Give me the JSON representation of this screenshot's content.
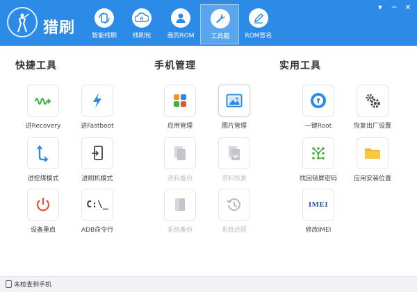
{
  "app": {
    "name": "猎刷"
  },
  "nav": {
    "tabs": [
      {
        "label": "智能线刷",
        "icon": "refresh-phone-icon"
      },
      {
        "label": "线刷包",
        "icon": "rom-package-icon"
      },
      {
        "label": "我的ROM",
        "icon": "user-icon"
      },
      {
        "label": "工具箱",
        "icon": "wrench-icon",
        "active": true
      },
      {
        "label": "ROM签名",
        "icon": "pen-icon"
      }
    ]
  },
  "window_controls": {
    "menu": "▾",
    "minimize": "─",
    "close": "✕"
  },
  "sections": {
    "quick": {
      "title": "快捷工具",
      "items": [
        {
          "label": "进Recovery",
          "icon": "wave-arrow-icon"
        },
        {
          "label": "进Fastboot",
          "icon": "lightning-icon"
        },
        {
          "label": "进挖煤模式",
          "icon": "hook-arrow-icon"
        },
        {
          "label": "进刷机模式",
          "icon": "enter-phone-icon"
        },
        {
          "label": "设备重启",
          "icon": "restart-icon"
        },
        {
          "label": "ADB命令行",
          "icon": "terminal-icon",
          "glyph": "C:\\_"
        }
      ]
    },
    "phone": {
      "title": "手机管理",
      "items": [
        {
          "label": "应用管理",
          "icon": "apps-grid-icon",
          "enabled": true
        },
        {
          "label": "图片管理",
          "icon": "picture-icon",
          "enabled": true
        },
        {
          "label": "资料备份",
          "icon": "backup-doc-icon",
          "enabled": false
        },
        {
          "label": "资料恢复",
          "icon": "restore-doc-icon",
          "enabled": false
        },
        {
          "label": "系统备份",
          "icon": "system-backup-icon",
          "enabled": false
        },
        {
          "label": "系统还原",
          "icon": "history-icon",
          "enabled": false
        }
      ]
    },
    "utility": {
      "title": "实用工具",
      "items": [
        {
          "label": "一键Root",
          "icon": "root-lock-icon"
        },
        {
          "label": "恢复出厂设置",
          "icon": "gears-icon"
        },
        {
          "label": "找回锁屏密码",
          "icon": "pattern-lock-icon"
        },
        {
          "label": "应用安装位置",
          "icon": "folder-icon"
        },
        {
          "label": "修改IMEI",
          "icon": "imei-icon",
          "glyph": "IMEI"
        }
      ]
    }
  },
  "status": {
    "text": "未检查到手机"
  },
  "colors": {
    "brand": "#2b8be6",
    "accent": "#2b8be6",
    "disabled": "#b8bcc0"
  }
}
